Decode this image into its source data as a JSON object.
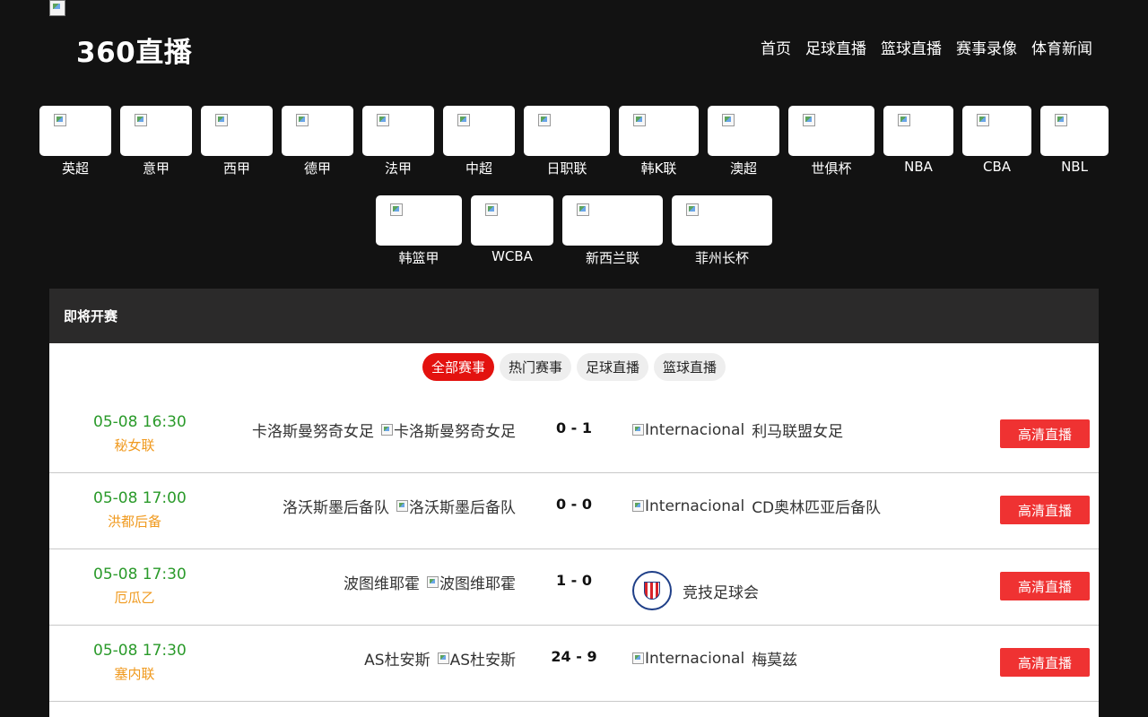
{
  "header": {
    "site_title": "360直播",
    "nav": [
      "首页",
      "足球直播",
      "篮球直播",
      "赛事录像",
      "体育新闻"
    ]
  },
  "leagues": {
    "row1": [
      "英超",
      "意甲",
      "西甲",
      "德甲",
      "法甲",
      "中超",
      "日职联",
      "韩K联",
      "澳超",
      "世俱杯",
      "NBA",
      "CBA",
      "NBL"
    ],
    "row2": [
      "韩篮甲",
      "WCBA",
      "新西兰联",
      "菲州长杯"
    ]
  },
  "panel": {
    "title": "即将开赛",
    "filters": [
      "全部赛事",
      "热门赛事",
      "足球直播",
      "篮球直播"
    ],
    "active_filter": "全部赛事",
    "live_label": "高清直播"
  },
  "matches": [
    {
      "time": "05-08 16:30",
      "league": "秘女联",
      "home": "卡洛斯曼努奇女足",
      "home_img_alt": "卡洛斯曼努奇女足",
      "score": "0 - 1",
      "away_img_alt": "Internacional",
      "away": "利马联盟女足"
    },
    {
      "time": "05-08 17:00",
      "league": "洪都后备",
      "home": "洛沃斯墨后备队",
      "home_img_alt": "洛沃斯墨后备队",
      "score": "0 - 0",
      "away_img_alt": "Internacional",
      "away": "CD奥林匹亚后备队"
    },
    {
      "time": "05-08 17:30",
      "league": "厄瓜乙",
      "home": "波图维耶霍",
      "home_img_alt": "波图维耶霍",
      "score": "1 - 0",
      "away_img_alt": "",
      "away": "竞技足球会"
    },
    {
      "time": "05-08 17:30",
      "league": "塞内联",
      "home": "AS杜安斯",
      "home_img_alt": "AS杜安斯",
      "score": "24 - 9",
      "away_img_alt": "Internacional",
      "away": "梅莫兹"
    }
  ],
  "colors": {
    "accent": "#e3120f",
    "button": "#ef3232",
    "time": "#2a9a2a",
    "league": "#f09a1f",
    "panel_head": "#2b2a2a"
  },
  "icons": {
    "logo": "broken-image-icon",
    "league": "broken-image-icon",
    "crest": "club-crest-icon"
  }
}
